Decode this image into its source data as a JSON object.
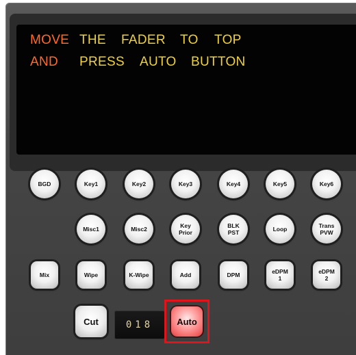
{
  "screen": {
    "line1": {
      "w1": "MOVE",
      "w2": "THE",
      "w3": "FADER",
      "w4": "TO",
      "w5": "TOP"
    },
    "line2": {
      "w1": "AND",
      "w2": "PRESS",
      "w3": "AUTO",
      "w4": "BUTTON"
    },
    "colors": {
      "highlight": "#ff6a28",
      "text": "#f0d23a"
    }
  },
  "row1": [
    "BGD",
    "Key1",
    "Key2",
    "Key3",
    "Key4",
    "Key5",
    "Key6"
  ],
  "row2": [
    "Misc1",
    "Misc2",
    "Key Prior",
    "BLK PST",
    "Loop",
    "Trans PVW"
  ],
  "row3": [
    "Mix",
    "Wipe",
    "K-Wipe",
    "Add",
    "DPM",
    "eDPM 1",
    "eDPM 2"
  ],
  "transition": {
    "cut_label": "Cut",
    "counter": "018",
    "auto_label": "Auto",
    "highlight_color": "#e0141b"
  }
}
